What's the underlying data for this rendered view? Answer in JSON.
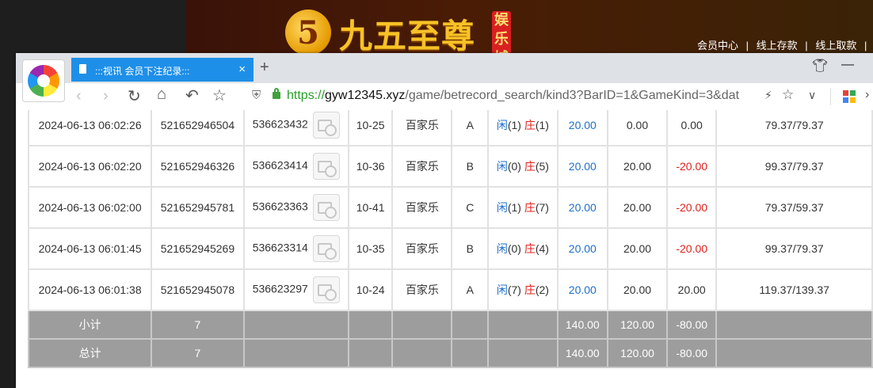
{
  "site": {
    "logo_glyph": "5",
    "logo_text": "九五至尊",
    "logo_tag": "娱乐城",
    "links": [
      "会员中心",
      "|",
      "线上存款",
      "|",
      "线上取款",
      "|",
      "—"
    ]
  },
  "browser": {
    "tab_title": ":::视讯 会员下注纪录:::",
    "tab_close": "×",
    "new_tab": "+",
    "url": {
      "scheme": "https://",
      "host": "gyw12345.xyz",
      "path": "/game/betrecord_search/kind3?BarID=1&GameKind=3&dat"
    }
  },
  "table": {
    "rows": [
      {
        "time": "2024-06-13 06:02:26",
        "order": "521652946504",
        "game_id": "536623432",
        "round": "10-25",
        "game": "百家乐",
        "table": "A",
        "xian_label": "闲",
        "xian_num": "(1)",
        "zhuang_label": "庄",
        "zhuang_num": "(1)",
        "bet": "20.00",
        "valid": "0.00",
        "win": "0.00",
        "balance": "79.37/79.37"
      },
      {
        "time": "2024-06-13 06:02:20",
        "order": "521652946326",
        "game_id": "536623414",
        "round": "10-36",
        "game": "百家乐",
        "table": "B",
        "xian_label": "闲",
        "xian_num": "(0)",
        "zhuang_label": "庄",
        "zhuang_num": "(5)",
        "bet": "20.00",
        "valid": "20.00",
        "win": "-20.00",
        "balance": "99.37/79.37"
      },
      {
        "time": "2024-06-13 06:02:00",
        "order": "521652945781",
        "game_id": "536623363",
        "round": "10-41",
        "game": "百家乐",
        "table": "C",
        "xian_label": "闲",
        "xian_num": "(1)",
        "zhuang_label": "庄",
        "zhuang_num": "(7)",
        "bet": "20.00",
        "valid": "20.00",
        "win": "-20.00",
        "balance": "79.37/59.37"
      },
      {
        "time": "2024-06-13 06:01:45",
        "order": "521652945269",
        "game_id": "536623314",
        "round": "10-35",
        "game": "百家乐",
        "table": "B",
        "xian_label": "闲",
        "xian_num": "(0)",
        "zhuang_label": "庄",
        "zhuang_num": "(4)",
        "bet": "20.00",
        "valid": "20.00",
        "win": "-20.00",
        "balance": "99.37/79.37"
      },
      {
        "time": "2024-06-13 06:01:38",
        "order": "521652945078",
        "game_id": "536623297",
        "round": "10-24",
        "game": "百家乐",
        "table": "A",
        "xian_label": "闲",
        "xian_num": "(7)",
        "zhuang_label": "庄",
        "zhuang_num": "(2)",
        "bet": "20.00",
        "valid": "20.00",
        "win": "20.00",
        "balance": "119.37/139.37"
      }
    ],
    "subtotal": {
      "label": "小计",
      "count": "7",
      "bet": "140.00",
      "valid": "120.00",
      "win": "-80.00"
    },
    "total": {
      "label": "总计",
      "count": "7",
      "bet": "140.00",
      "valid": "120.00",
      "win": "-80.00"
    }
  }
}
